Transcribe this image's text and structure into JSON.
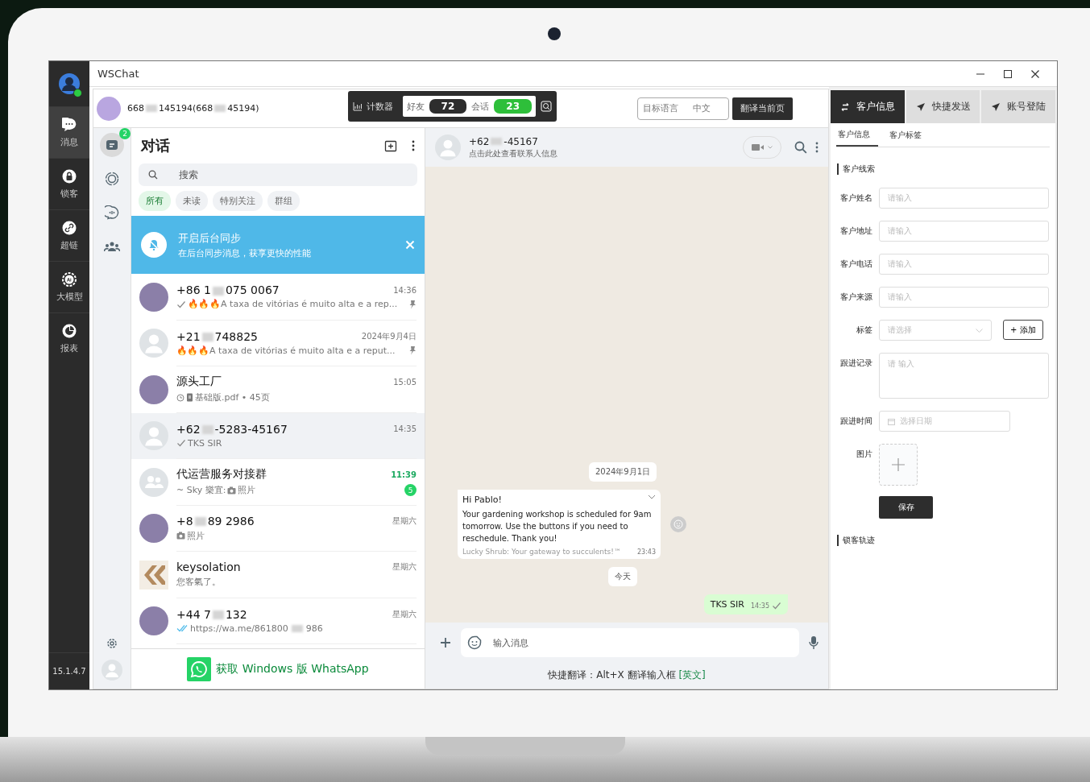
{
  "window": {
    "title": "WSChat"
  },
  "rail": {
    "items": [
      {
        "kind": "chat",
        "label": "消息",
        "selected": true
      },
      {
        "kind": "lock",
        "label": "锁客",
        "selected": false
      },
      {
        "kind": "link",
        "label": "超链",
        "selected": false
      },
      {
        "kind": "ai",
        "label": "大模型",
        "selected": false
      },
      {
        "kind": "chart",
        "label": "报表",
        "selected": false
      }
    ],
    "version": "15.1.4.7"
  },
  "account": {
    "id_parts": [
      "668",
      "145194(668",
      "45194)"
    ]
  },
  "counter": {
    "label": "计数器",
    "friends_label": "好友",
    "friends": "72",
    "sessions_label": "会话",
    "sessions": "23"
  },
  "translate": {
    "target_label": "目标语言",
    "target": "中文",
    "button": "翻译当前页"
  },
  "side_nav": [
    {
      "kind": "chats",
      "selected": true,
      "badge": "2"
    },
    {
      "kind": "status",
      "selected": false
    },
    {
      "kind": "channels",
      "selected": false
    },
    {
      "kind": "communities",
      "selected": false
    }
  ],
  "chat_list": {
    "title": "对话",
    "search_placeholder": "搜索",
    "filters": [
      {
        "label": "所有",
        "selected": true
      },
      {
        "label": "未读",
        "selected": false
      },
      {
        "label": "特别关注",
        "selected": false
      },
      {
        "label": "群组",
        "selected": false
      }
    ],
    "banner": {
      "title": "开启后台同步",
      "text": "在后台同步消息，获享更快的性能"
    },
    "chats": [
      {
        "kind": "photo",
        "name_parts": [
          "+86 1",
          "075 0067"
        ],
        "time": "14:36",
        "delivered": true,
        "preview_parts": [
          "🔥🔥🔥A taxa de vitórias é muito alta e a rep..."
        ],
        "pinned": true,
        "selected": false
      },
      {
        "kind": "default",
        "name_parts": [
          "+21",
          "748825"
        ],
        "time": "2024年9月4日",
        "preview_parts": [
          "🔥🔥🔥A taxa de vitórias é muito alta e a reput..."
        ],
        "pinned": true,
        "selected": false
      },
      {
        "kind": "photo",
        "name_parts": [
          "源头工厂"
        ],
        "time": "15:05",
        "pending": true,
        "document": true,
        "preview_parts": [
          "基础版.pdf • 45页"
        ],
        "pinned": false,
        "selected": false
      },
      {
        "kind": "default",
        "name_parts": [
          "+62",
          "-5283-45167"
        ],
        "time": "14:35",
        "delivered": true,
        "preview_parts": [
          "TKS SIR"
        ],
        "pinned": false,
        "selected": true
      },
      {
        "kind": "group",
        "name_parts": [
          "代运营服务对接群"
        ],
        "time": "11:39",
        "preview_prefix": "~ Sky 樂宜:",
        "photo": true,
        "preview_parts": [
          "照片"
        ],
        "unread": "5",
        "pinned": false,
        "selected": false
      },
      {
        "kind": "photo",
        "name_parts": [
          "+8",
          "89 2986"
        ],
        "time": "星期六",
        "photo": true,
        "preview_parts": [
          "照片"
        ],
        "pinned": false,
        "selected": false
      },
      {
        "kind": "logo",
        "name_parts": [
          "keysolation"
        ],
        "time": "星期六",
        "preview_parts": [
          "您客氣了。"
        ],
        "pinned": false,
        "selected": false
      },
      {
        "kind": "photo",
        "name_parts": [
          "+44 7",
          "132"
        ],
        "time": "星期六",
        "read": true,
        "preview_parts": [
          "https://wa.me/861800",
          "986"
        ],
        "pinned": false,
        "selected": false
      }
    ],
    "promo": "获取 Windows 版 WhatsApp"
  },
  "chat": {
    "name_parts": [
      "+62",
      "-45167"
    ],
    "subtitle": "点击此处查看联系人信息",
    "messages": [
      {
        "kind": "date",
        "text": "2024年9月1日"
      },
      {
        "kind": "incoming",
        "title": "Hi Pablo!",
        "body": "Your gardening workshop is scheduled for 9am tomorrow. Use the buttons if you need to reschedule. Thank you!",
        "footer": "Lucky Shrub: Your gateway to succulents!™",
        "time": "23:43"
      },
      {
        "kind": "date",
        "text": "今天"
      },
      {
        "kind": "outgoing",
        "text": "TKS SIR",
        "time": "14:35",
        "delivered": true
      }
    ],
    "input_placeholder": "输入消息",
    "hint": "快捷翻译：Alt+X 翻译输入框 ",
    "hint_link": "[英文]"
  },
  "customer_panel": {
    "tabs": [
      {
        "label": "客户信息",
        "selected": true
      },
      {
        "label": "快捷发送",
        "selected": false
      },
      {
        "label": "账号登陆",
        "selected": false
      }
    ],
    "subtabs": [
      {
        "label": "客户信息",
        "selected": true
      },
      {
        "label": "客户标签",
        "selected": false
      }
    ],
    "section": "客户线索",
    "fields": [
      {
        "kind": "text",
        "label": "客户姓名",
        "placeholder": "请输入"
      },
      {
        "kind": "text",
        "label": "客户地址",
        "placeholder": "请输入"
      },
      {
        "kind": "text",
        "label": "客户电话",
        "placeholder": "请输入"
      },
      {
        "kind": "text",
        "label": "客户来源",
        "placeholder": "请输入"
      },
      {
        "kind": "select",
        "label": "标签",
        "placeholder": "请选择",
        "button": "+ 添加"
      },
      {
        "kind": "textarea",
        "label": "跟进记录",
        "placeholder": "请 输入"
      },
      {
        "kind": "date",
        "label": "跟进时间",
        "placeholder": "选择日期"
      },
      {
        "kind": "upload",
        "label": "图片"
      }
    ],
    "save": "保存",
    "section2": "锁客轨迹"
  }
}
